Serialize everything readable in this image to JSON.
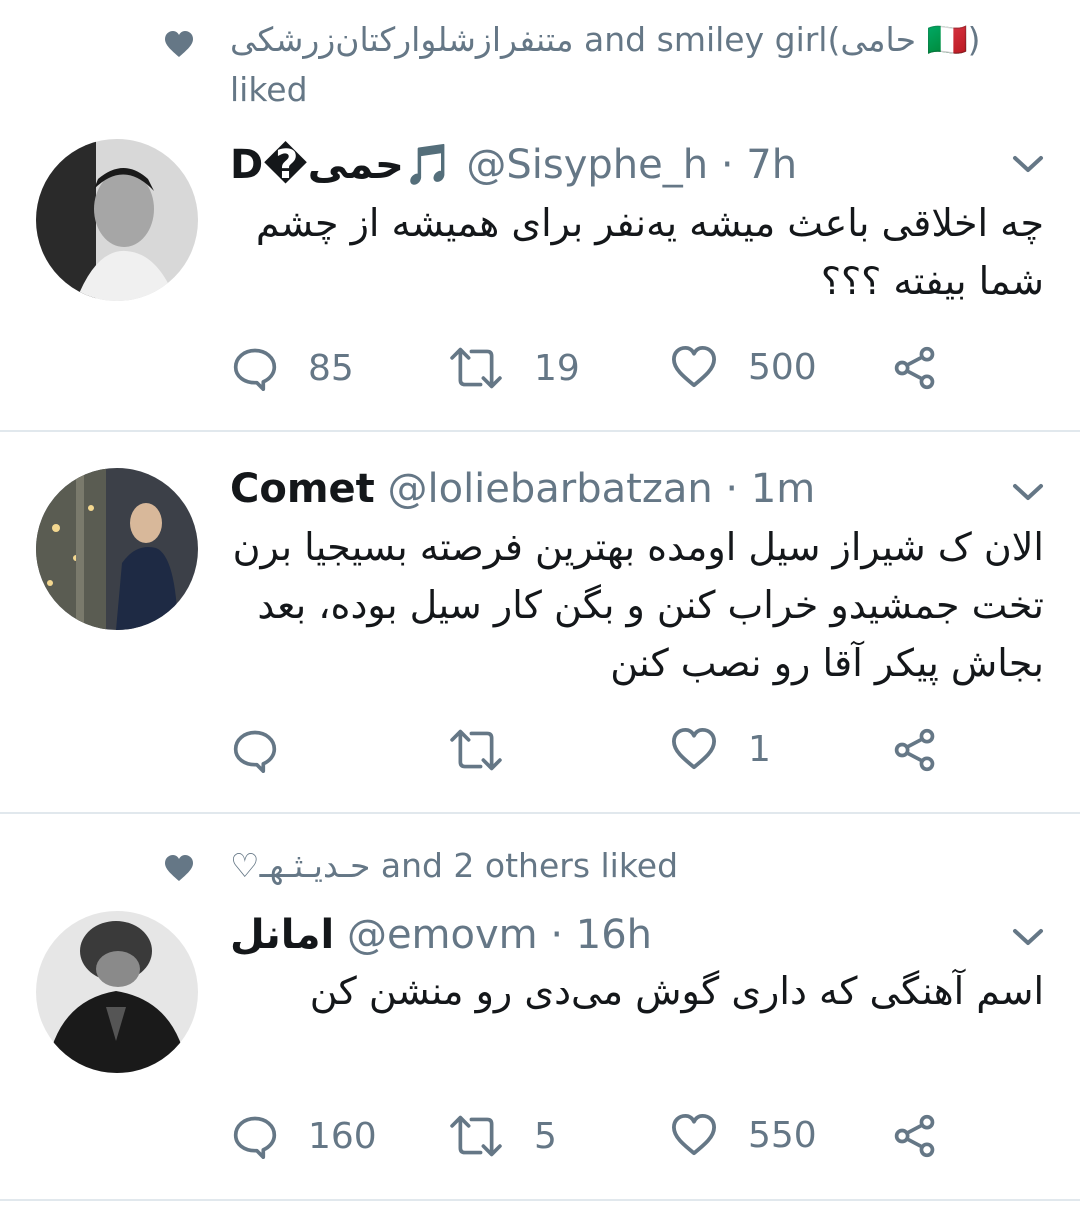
{
  "tweets": [
    {
      "social_context": {
        "names": "متنفرازشلوارکتان‌زرشکی",
        "connector": "and smiley girl(حامی 🇮🇹)",
        "suffix": "liked"
      },
      "author": {
        "name": "D�حمی🎵",
        "handle": "@Sisyphe_h",
        "separator": "·",
        "time": "7h"
      },
      "text": "چه اخلاقی باعث میشه یه‌نفر برای همیشه از چشم شما بیفته ؟؟؟",
      "counts": {
        "reply": "85",
        "retweet": "19",
        "like": "500"
      }
    },
    {
      "author": {
        "name": "Comet",
        "handle": "@loliebarbatzan",
        "separator": "·",
        "time": "1m"
      },
      "text": "الان ک شیراز سیل اومده بهترین فرصته بسیجیا برن تخت جمشیدو خراب کنن و بگن کار سیل بوده، بعد بجاش پیکر آقا رو نصب کنن",
      "counts": {
        "reply": "",
        "retweet": "",
        "like": "1"
      }
    },
    {
      "social_context": {
        "names": "♡حـديـثـهـ",
        "connector": "and 2 others liked"
      },
      "author": {
        "name": "امانل",
        "handle": "@emovm",
        "separator": "·",
        "time": "16h"
      },
      "text": "اسم آهنگی که داری گوش می‌دی رو منشن کن",
      "counts": {
        "reply": "160",
        "retweet": "5",
        "like": "550"
      }
    }
  ],
  "colors": {
    "text": "#14171a",
    "secondary": "#657786",
    "divider": "#e1e8ed"
  },
  "icons": [
    "heart-filled-icon",
    "reply-icon",
    "retweet-icon",
    "like-icon",
    "share-icon",
    "chevron-down-icon"
  ]
}
